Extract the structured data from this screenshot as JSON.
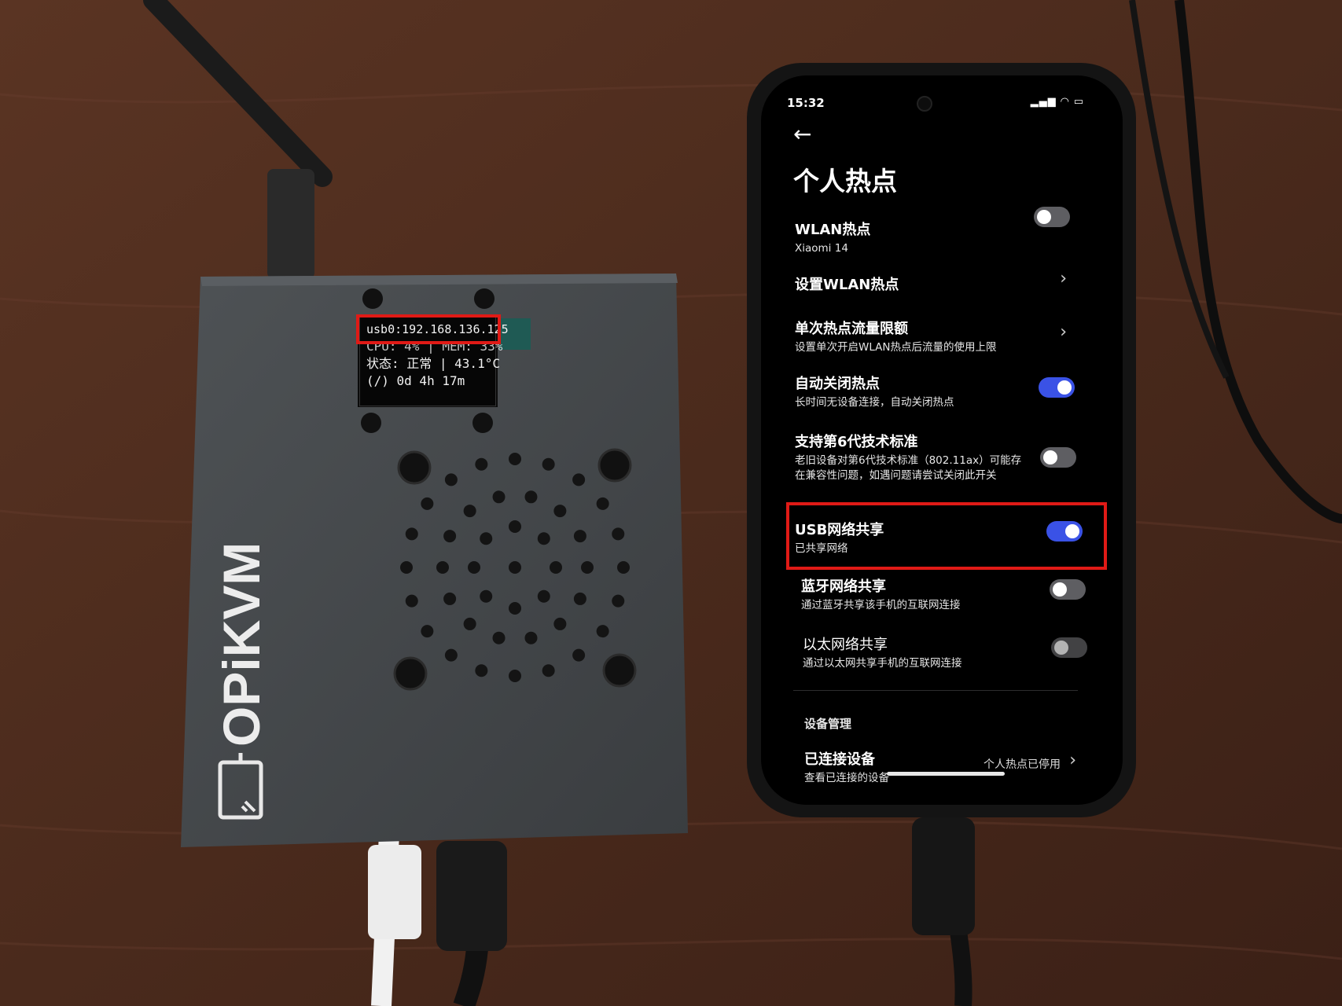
{
  "kvm": {
    "brand": "OPiKVM",
    "oled_lines": [
      "usb0:192.168.136.125",
      "CPU: 4% | MEM: 33%",
      "状态: 正常 | 43.1°C",
      "(/) 0d 4h 17m"
    ]
  },
  "phone": {
    "status_time": "15:32",
    "status_icons": "▂▄▆ ◠ ▭",
    "back_icon": "←",
    "title": "个人热点",
    "settings": [
      {
        "title": "WLAN热点",
        "subtitle": "Xiaomi 14",
        "control": "toggle-off"
      },
      {
        "title": "设置WLAN热点",
        "subtitle": "",
        "control": "chevron"
      },
      {
        "title": "单次热点流量限额",
        "subtitle": "设置单次开启WLAN热点后流量的使用上限",
        "control": "chevron"
      },
      {
        "title": "自动关闭热点",
        "subtitle": "长时间无设备连接，自动关闭热点",
        "control": "toggle-on"
      },
      {
        "title": "支持第6代技术标准",
        "subtitle": "老旧设备对第6代技术标准（802.11ax）可能存在兼容性问题，如遇问题请尝试关闭此开关",
        "control": "toggle-off"
      },
      {
        "title": "USB网络共享",
        "subtitle": "已共享网络",
        "control": "toggle-on"
      },
      {
        "title": "蓝牙网络共享",
        "subtitle": "通过蓝牙共享该手机的互联网连接",
        "control": "toggle-off"
      },
      {
        "title": "以太网络共享",
        "subtitle": "通过以太网共享手机的互联网连接",
        "control": "toggle-off"
      }
    ],
    "section_header": "设备管理",
    "connected_devices": {
      "title": "已连接设备",
      "subtitle": "查看已连接的设备",
      "note": "个人热点已停用"
    },
    "chevron": "›"
  },
  "colors": {
    "highlight": "#e01a16",
    "toggle_on": "#3a52e6",
    "toggle_off": "#5e5e62"
  }
}
